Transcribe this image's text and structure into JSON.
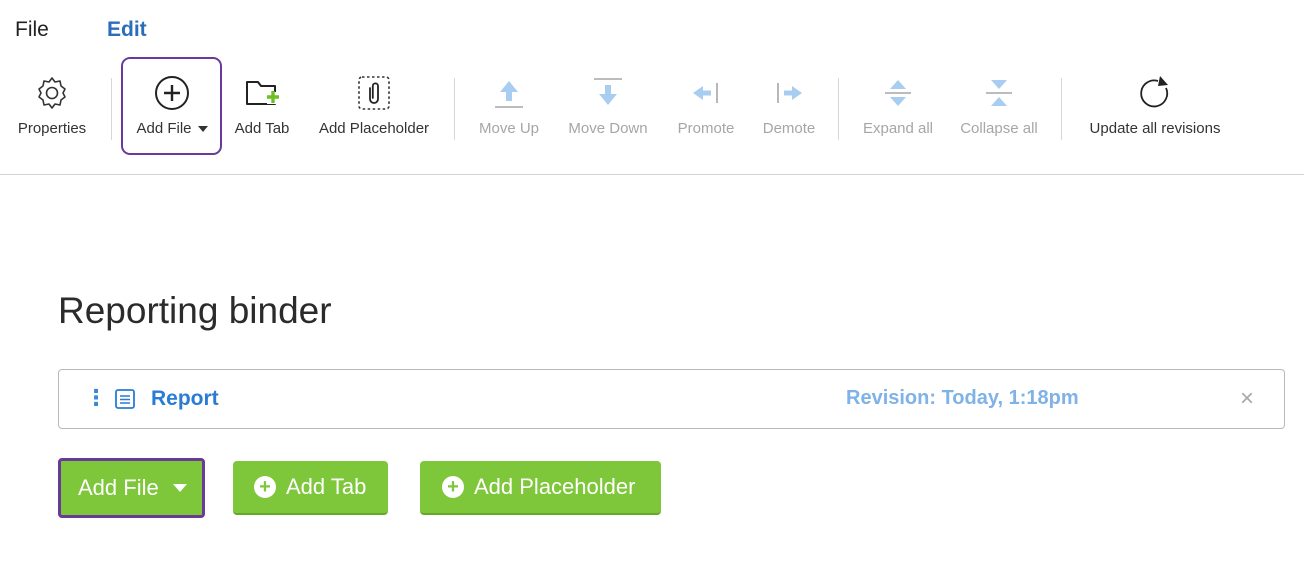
{
  "menu": {
    "file": "File",
    "edit": "Edit"
  },
  "ribbon": {
    "properties": "Properties",
    "add_file": "Add File",
    "add_tab": "Add Tab",
    "add_placeholder": "Add Placeholder",
    "move_up": "Move Up",
    "move_down": "Move Down",
    "promote": "Promote",
    "demote": "Demote",
    "expand_all": "Expand all",
    "collapse_all": "Collapse all",
    "update_all": "Update all revisions"
  },
  "binder": {
    "title": "Reporting binder",
    "items": [
      {
        "handle": "⋮",
        "name": "Report",
        "revision": "Revision: Today, 1:18pm",
        "close": "×"
      }
    ]
  },
  "actions": {
    "add_file": "Add File",
    "add_tab": "Add Tab",
    "add_placeholder": "Add Placeholder"
  },
  "colors": {
    "accent_blue": "#2a7bd4",
    "green": "#7ec63a",
    "highlight": "#6a3a9a",
    "disabled_icon": "#a9cdf0"
  }
}
